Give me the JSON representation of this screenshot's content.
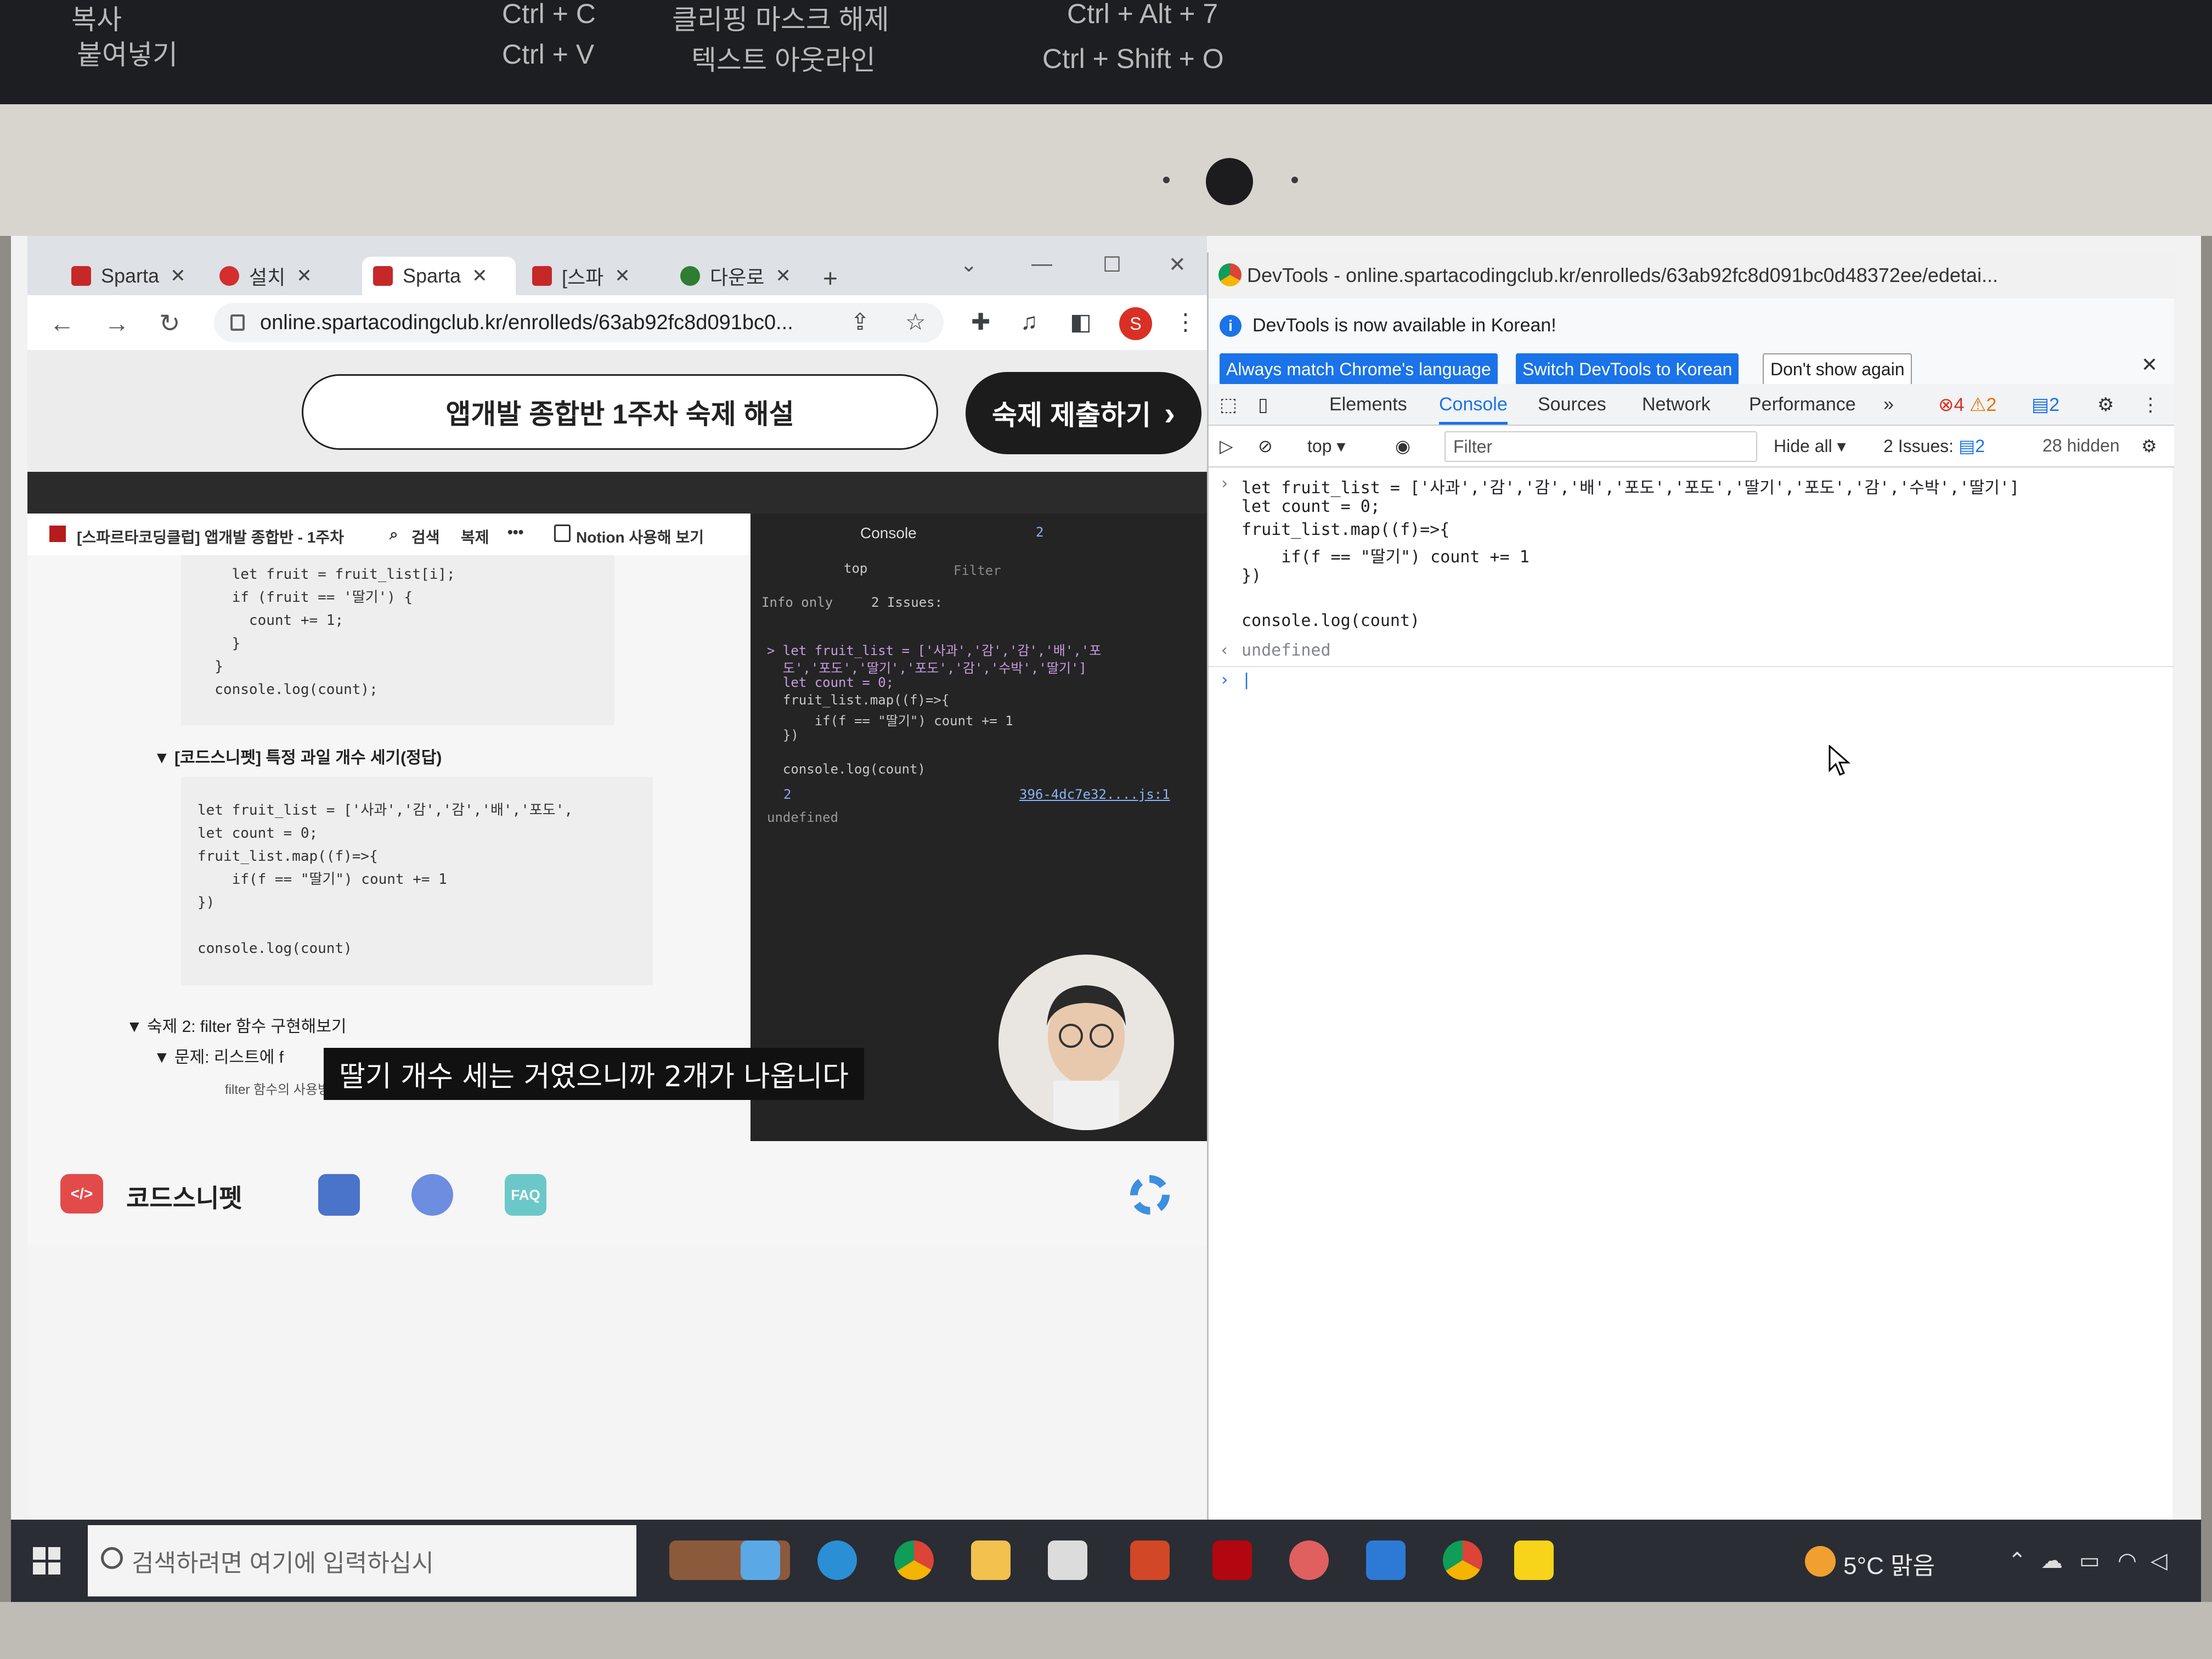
{
  "keyboard_labels": {
    "copy": "복사",
    "copy_shortcut": "Ctrl + C",
    "paste": "붙여넣기",
    "paste_shortcut": "Ctrl + V",
    "clip_mask_release": "클리핑 마스크 해제",
    "clip_mask_shortcut": "Ctrl + Alt + 7",
    "text_outline": "텍스트 아웃라인",
    "text_outline_shortcut": "Ctrl + Shift + O"
  },
  "browser": {
    "tabs": [
      {
        "label": "Sparta",
        "favicon_color": "#c62828",
        "active": false
      },
      {
        "label": "설치",
        "favicon_color": "#d32f2f",
        "active": false
      },
      {
        "label": "Sparta",
        "favicon_color": "#c62828",
        "active": true
      },
      {
        "label": "[스파",
        "favicon_color": "#c62828",
        "active": false
      },
      {
        "label": "다운로",
        "favicon_color": "#2e7d32",
        "active": false
      }
    ],
    "new_tab": "+",
    "url": "online.spartacodingclub.kr/enrolleds/63ab92fc8d091bc0...",
    "profile_initial": "S"
  },
  "page": {
    "homework_title": "앱개발 종합반 1주차 숙제 해설",
    "submit_button": "숙제 제출하기",
    "submit_chevron": "›"
  },
  "video": {
    "notion_breadcrumb": "[스파르타코딩클럽] 앱개발 종합반 - 1주차",
    "notion_search": "검색",
    "notion_duplicate": "복제",
    "notion_more": "•••",
    "notion_open": "Notion 사용해 보기",
    "code_top": "    let fruit = fruit_list[i];\n    if (fruit == '딸기') {\n      count += 1;\n    }\n  }\n  console.log(count);",
    "toggle_correct": "[코드스니펫] 특정 과일 개수 세기(정답)",
    "code_answer": "let fruit_list = ['사과','감','감','배','포도',\nlet count = 0;\nfruit_list.map((f)=>{\n    if(f == \"딸기\") count += 1\n})\n\nconsole.log(count)",
    "hw2_toggle": "숙제 2: filter 함수 구현해보기",
    "hw2_sub": "문제: 리스트에 f",
    "hw2_line": "filter 함수의 사용방법을 찾아보세요. 나오? 찾아보기",
    "mini_console_tab": "Console",
    "mini_issue_count": "2",
    "mini_top": "top",
    "mini_filter": "Filter",
    "mini_info_only": "Info only",
    "mini_issues": "2 Issues:",
    "mini_lines": [
      "> let fruit_list = ['사과','감','감','배','포",
      "  도','포도','딸기','포도','감','수박','딸기']",
      "  let count = 0;",
      "  fruit_list.map((f)=>{",
      "      if(f == \"딸기\") count += 1",
      "  })",
      "",
      "  console.log(count)"
    ],
    "mini_output": "2",
    "mini_source": "396-4dc7e32....js:1",
    "mini_undefined": "undefined",
    "subtitle": "딸기 개수 세는 거였으니까 2개가 나옵니다"
  },
  "snippet_bar": {
    "logo_text": "</>",
    "name": "코드스니펫",
    "faq": "FAQ"
  },
  "devtools": {
    "title": "DevTools - online.spartacodingclub.kr/enrolleds/63ab92fc8d091bc0d48372ee/edetai...",
    "info_message": "DevTools is now available in Korean!",
    "btn_match": "Always match Chrome's language",
    "btn_switch": "Switch DevTools to Korean",
    "btn_dont_show": "Don't show again",
    "tabs": [
      "Elements",
      "Console",
      "Sources",
      "Network",
      "Performance"
    ],
    "tabs_more": "»",
    "error_count": "4",
    "warning_count": "2",
    "issue_badge": "2",
    "context": "top",
    "filter_placeholder": "Filter",
    "hide_all": "Hide all",
    "issues_label": "2 Issues:",
    "issues_count": "2",
    "hidden_count": "28 hidden",
    "console": {
      "line1": "let fruit_list = ['사과','감','감','배','포도','포도','딸기','포도','감','수박','딸기']",
      "line2": "let count = 0;",
      "line3": "fruit_list.map((f)=>{",
      "line4": "    if(f == \"딸기\") count += 1",
      "line5": "})",
      "line6": "console.log(count)",
      "result": "undefined"
    }
  },
  "taskbar": {
    "search_placeholder": "검색하려면 여기에 입력하십시",
    "weather": "5°C 맑음"
  }
}
